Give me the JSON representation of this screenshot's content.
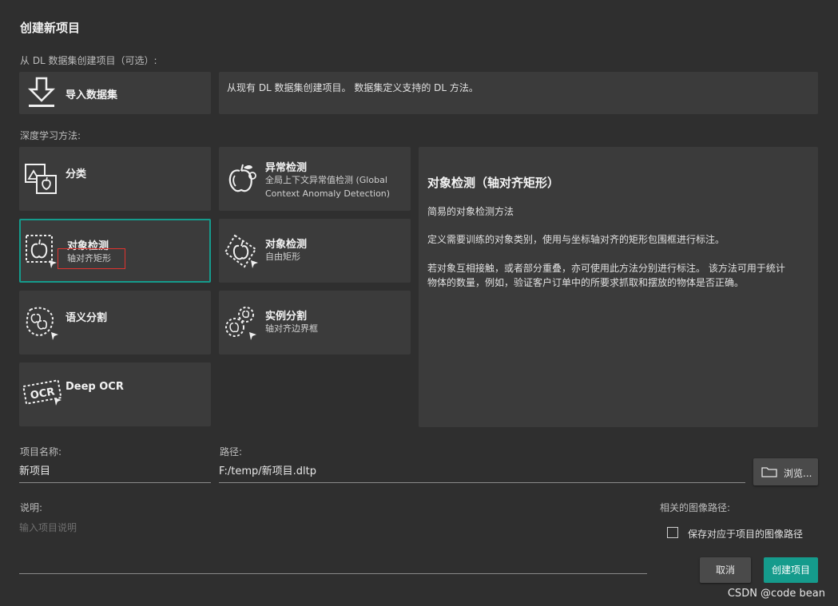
{
  "dialog": {
    "title": "创建新项目"
  },
  "dataset_section": {
    "label": "从 DL 数据集创建项目（可选）:",
    "import_button": "导入数据集",
    "description": "从现有 DL 数据集创建项目。 数据集定义支持的 DL 方法。"
  },
  "methods": {
    "label": "深度学习方法:",
    "items": [
      {
        "title": "分类",
        "sub": "",
        "icon": "classification-icon"
      },
      {
        "title": "异常检测",
        "sub": "全局上下文异常值检测 (Global Context Anomaly Detection)",
        "icon": "anomaly-detection-icon"
      },
      {
        "title": "对象检测",
        "sub": "轴对齐矩形",
        "icon": "object-detection-axis-icon",
        "selected": true
      },
      {
        "title": "对象检测",
        "sub": "自由矩形",
        "icon": "object-detection-free-icon"
      },
      {
        "title": "语义分割",
        "sub": "",
        "icon": "semantic-segmentation-icon"
      },
      {
        "title": "实例分割",
        "sub": "轴对齐边界框",
        "icon": "instance-segmentation-icon"
      },
      {
        "title": "Deep OCR",
        "sub": "",
        "icon": "ocr-icon"
      }
    ]
  },
  "detail_panel": {
    "title": "对象检测（轴对齐矩形）",
    "p1": "简易的对象检测方法",
    "p2": "定义需要训练的对象类别，使用与坐标轴对齐的矩形包围框进行标注。",
    "p3": "若对象互相接触，或者部分重叠，亦可使用此方法分别进行标注。 该方法可用于统计物体的数量，例如，验证客户订单中的所要求抓取和摆放的物体是否正确。"
  },
  "form": {
    "name_label": "项目名称:",
    "name_value": "新项目",
    "path_label": "路径:",
    "path_value": "F:/temp/新项目.dltp",
    "browse_button": "浏览...",
    "desc_label": "说明:",
    "desc_placeholder": "输入项目说明",
    "image_path_label": "相关的图像路径:",
    "save_checkbox_label": "保存对应于项目的图像路径",
    "save_checked": false
  },
  "footer": {
    "cancel": "取消",
    "create": "创建项目",
    "watermark": "CSDN @code bean"
  },
  "colors": {
    "accent": "#159b8c",
    "background": "#2f2f2f",
    "card": "#3b3b3b",
    "highlight_box": "#e0332f"
  }
}
